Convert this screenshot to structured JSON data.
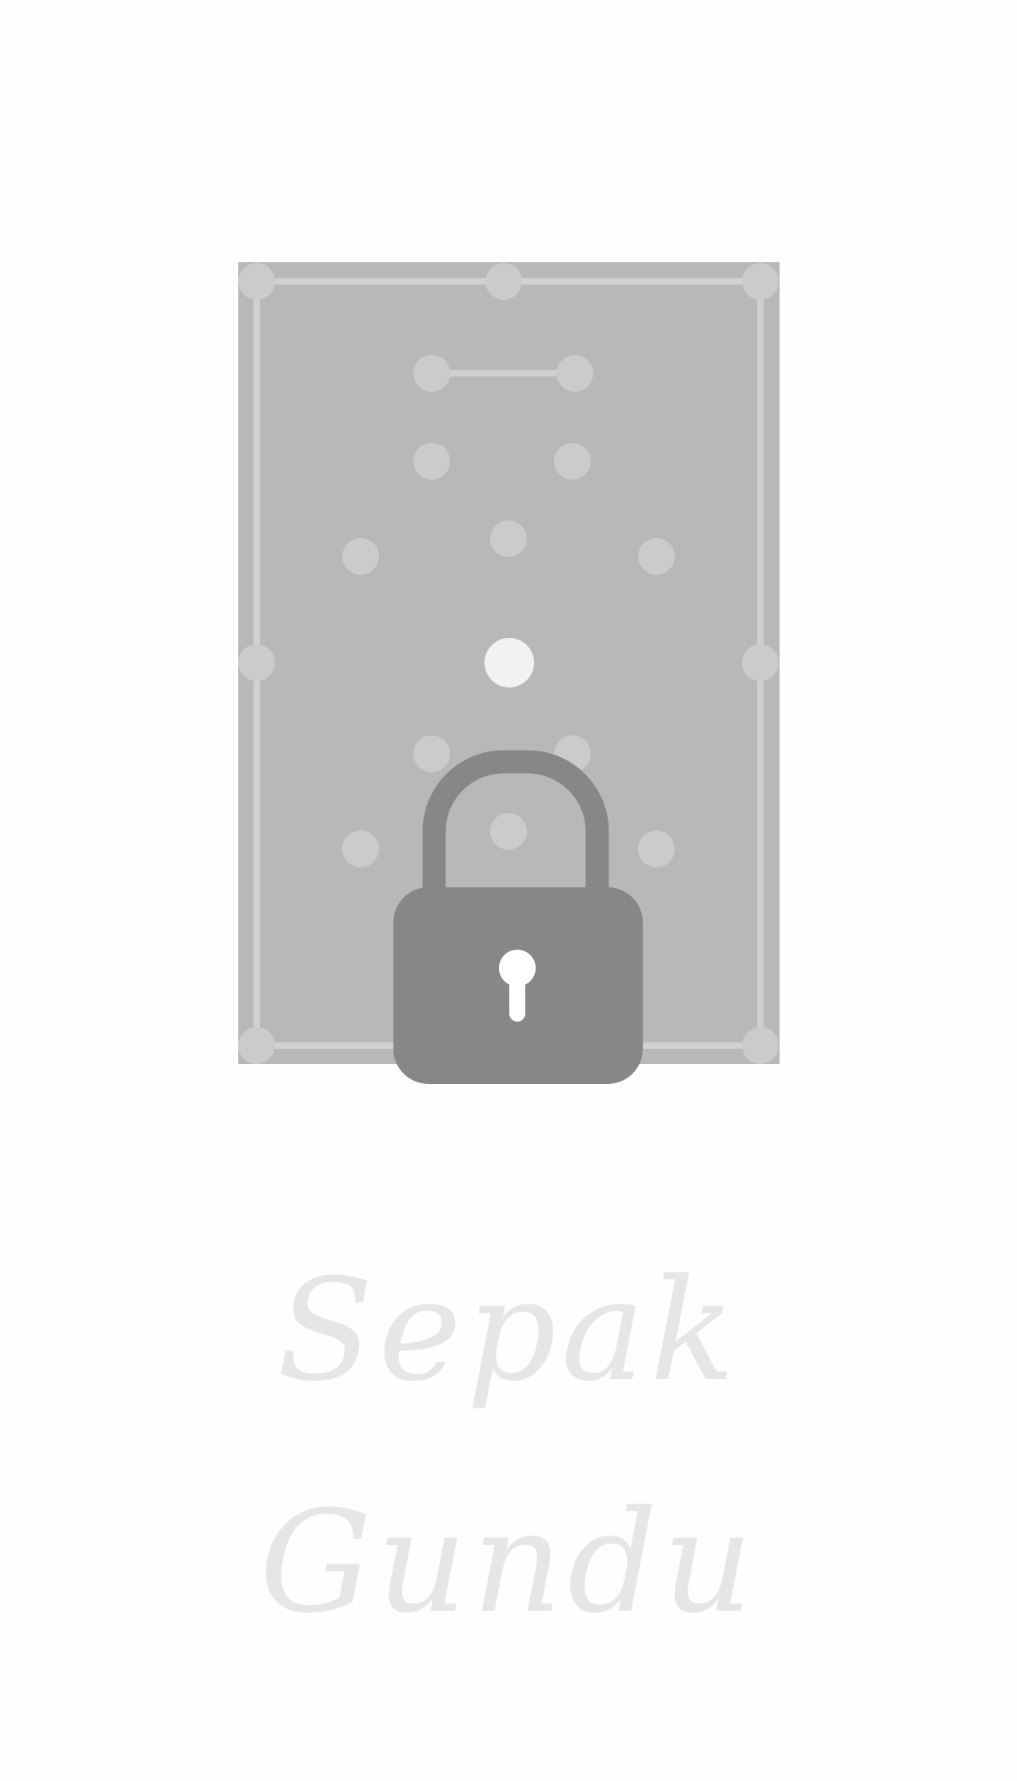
{
  "level": {
    "name_line1": "Sepak",
    "name_line2": "Gundu",
    "locked": true
  },
  "colors": {
    "background": "#fefefe",
    "board": "#b8b8b8",
    "board_border": "#d0d0d0",
    "peg": "#cbcbcb",
    "center_peg": "#f2f2f2",
    "lock_body": "#878787",
    "keyhole": "#ffffff",
    "title_text": "#e6e6e6"
  },
  "icons": {
    "lock": "padlock-icon"
  }
}
